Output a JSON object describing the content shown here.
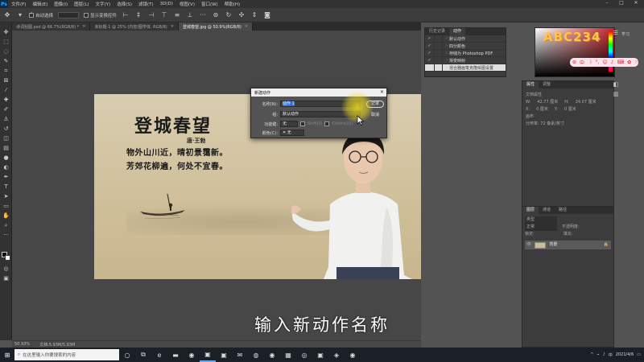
{
  "app": {
    "logo": "Ps"
  },
  "menu": [
    "文件(F)",
    "编辑(E)",
    "图像(I)",
    "图层(L)",
    "文字(Y)",
    "选择(S)",
    "滤镜(T)",
    "3D(D)",
    "视图(V)",
    "窗口(W)",
    "帮助(H)"
  ],
  "options": {
    "auto_select": "自动选择",
    "show_transform": "显示变换控件"
  },
  "tabs": [
    {
      "label": "诗词刮图.psd @ 66.7%(RGB/8) *"
    },
    {
      "label": "未标题-1 @ 25% (内容/图学体, RGB/8)"
    },
    {
      "label": "登城春望.jpg @ 50.9%(RGB/8)"
    }
  ],
  "poem": {
    "title": "登城春望",
    "author": "唐·王勃",
    "lines": [
      "物外山川近，晴初景霭新。",
      "芳郊花柳遍，何处不宜春。"
    ]
  },
  "dialog": {
    "title": "新建动作",
    "name_label": "名称(N):",
    "name_value": "动作 1",
    "set_label": "组:",
    "set_value": "默认动作",
    "fkey_label": "功能键:",
    "fkey_value": "无",
    "shift_label": "Shift(S)",
    "ctrl_label": "Control(O)",
    "color_label": "颜色(C):",
    "color_value": "无",
    "record_button": "记录",
    "cancel_button": "取消"
  },
  "subtitle": "输入新动作名称",
  "status": {
    "zoom": "50.93%",
    "doc": "文档:5.93M/5.93M"
  },
  "actions_panel": {
    "tabs": [
      "历史记录",
      "动作"
    ],
    "rows": [
      {
        "label": "默认动作"
      },
      {
        "label": "四分颜色"
      },
      {
        "label": "存储为 Photoshop PDF"
      },
      {
        "label": "渐变映射"
      },
      {
        "label": "混合器画笔克隆绘图设置"
      }
    ]
  },
  "right_side": {
    "learn": "学习"
  },
  "properties_panel": {
    "tabs": [
      "属性",
      "调整"
    ],
    "type": "文档属性",
    "label_w": "W:",
    "label_h": "H:",
    "label_x": "X:",
    "label_y": "Y:",
    "value_w": "42.77 厘米",
    "value_h": "24.07 厘米",
    "value_x": "0 厘米",
    "value_y": "0 厘米",
    "canvas_label": "画布",
    "resolution": "分辨率: 72 像素/英寸"
  },
  "layers_panel": {
    "tabs": [
      "图层",
      "通道",
      "路径"
    ],
    "kind": "类型",
    "mode": "正常",
    "opacity": "不透明度:",
    "lock": "锁定:",
    "fill": "填充:",
    "layer_name": "背景"
  },
  "taskbar": {
    "search_placeholder": "在这里输入你要搜索的内容",
    "time": "",
    "date": "2021/4/6"
  },
  "watermark": "ABC234"
}
